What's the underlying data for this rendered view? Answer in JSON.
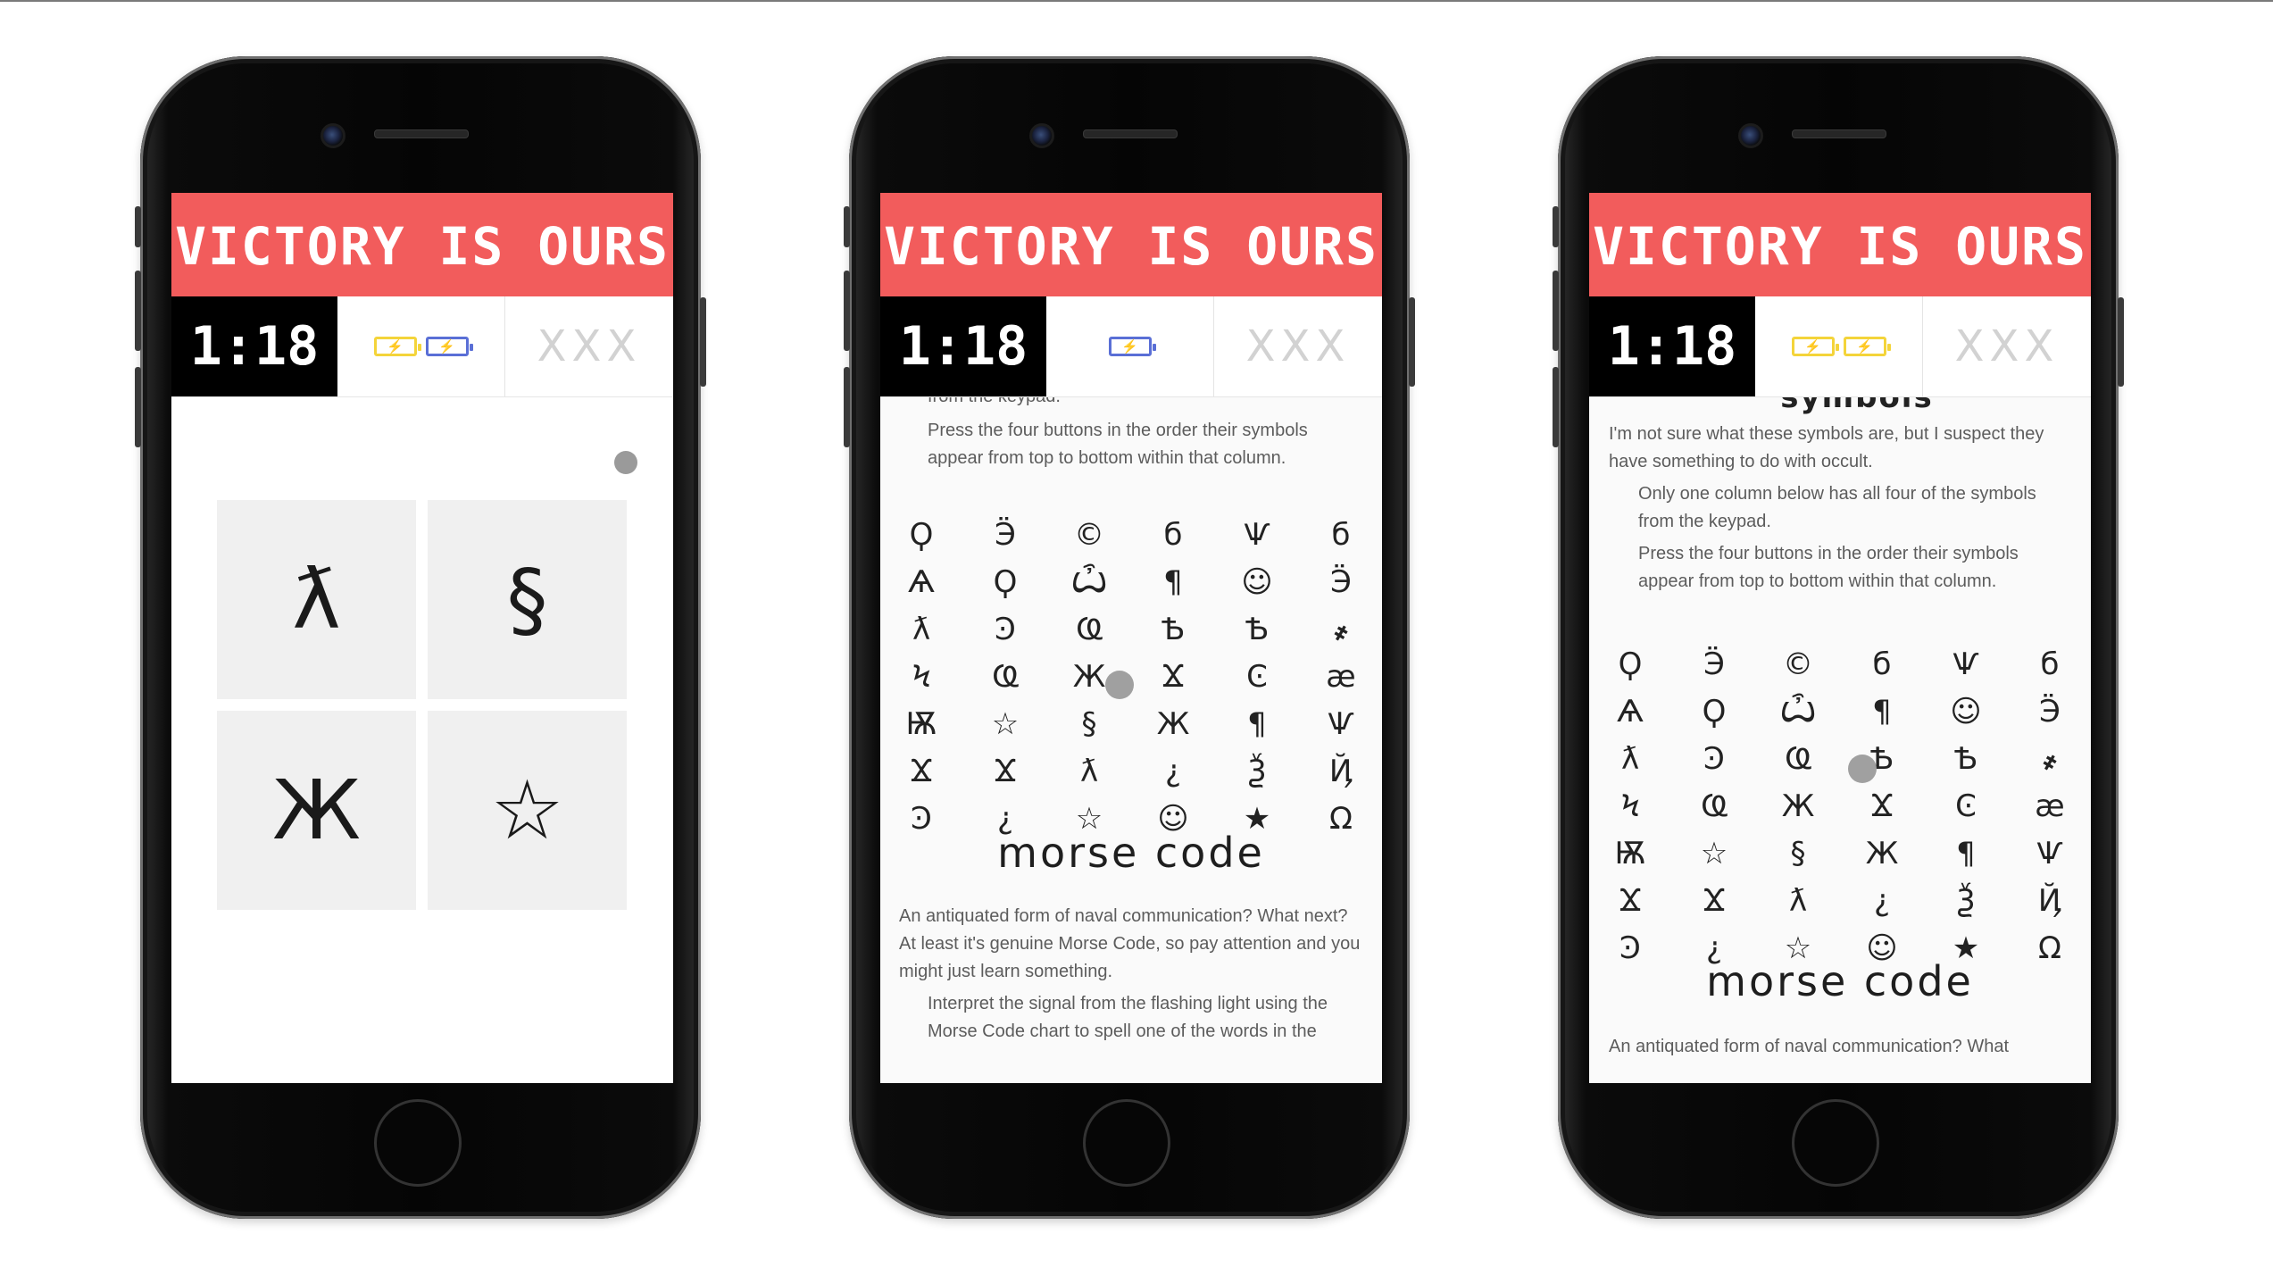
{
  "banner_title": "VICTORY IS OURS",
  "timer": "1:18",
  "strikes": "XXX",
  "colors": {
    "banner": "#f25c5c",
    "battery_yellow": "#f4d43a",
    "battery_blue": "#5a6fd6"
  },
  "icons": {
    "battery": "battery-charge-icon",
    "bolt": "⚡"
  },
  "phone1": {
    "batteries": [
      "yellow",
      "blue"
    ],
    "keypad": [
      "ƛ",
      "§",
      "Ж",
      "☆"
    ]
  },
  "phone2": {
    "batteries": [
      "blue"
    ],
    "top_partial_text": "from the keypad.",
    "instruction_order": "Press the four buttons in the order their symbols appear from top to bottom within that column.",
    "morse_heading": "morse code",
    "morse_intro": "An antiquated form of naval communication? What next? At least it's genuine Morse Code, so pay attention and you might just learn something.",
    "morse_instruction": "Interpret the signal from the flashing light using the Morse Code chart to spell one of the words in the"
  },
  "phone3": {
    "batteries": [
      "yellow",
      "yellow"
    ],
    "partial_heading": "symbols",
    "intro": "I'm not sure what these symbols are, but I suspect they have something to do with occult.",
    "instruction_column": "Only one column below has all four of the symbols from the keypad.",
    "instruction_order": "Press the four buttons in the order their symbols appear from top to bottom within that column.",
    "morse_heading": "morse code",
    "morse_intro_partial": "An antiquated form of naval communication? What"
  },
  "symbol_grid": [
    [
      "Ϙ",
      "Ӭ",
      "©",
      "б",
      "Ѱ",
      "б"
    ],
    [
      "Ѧ",
      "Ϙ",
      "Ѽ",
      "¶",
      "☺",
      "Ӭ"
    ],
    [
      "ƛ",
      "Ͽ",
      "Ҩ",
      "Ѣ",
      "Ѣ",
      "҂"
    ],
    [
      "Ϟ",
      "Ҩ",
      "Ж",
      "Ϫ",
      "Ͼ",
      "æ"
    ],
    [
      "Ѭ",
      "☆",
      "§",
      "Ж",
      "¶",
      "Ѱ"
    ],
    [
      "Ϫ",
      "Ϫ",
      "ƛ",
      "¿",
      "Ѯ",
      "Ҋ"
    ],
    [
      "Ͽ",
      "¿",
      "☆",
      "☺",
      "★",
      "Ω"
    ]
  ]
}
